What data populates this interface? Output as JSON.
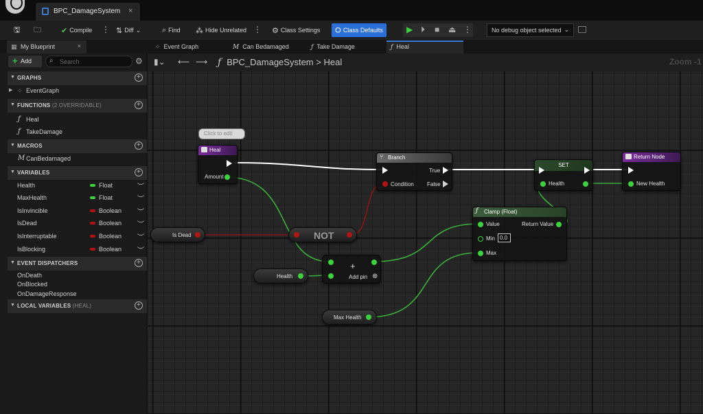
{
  "title_bar": {
    "document_tab": "BPC_DamageSystem",
    "close": "×"
  },
  "toolbar": {
    "compile": "Compile",
    "diff": "Diff",
    "find": "Find",
    "hide_unrelated": "Hide Unrelated",
    "class_settings": "Class Settings",
    "class_defaults": "Class Defaults",
    "debug_object": "No debug object selected",
    "accent": "#2a70d8"
  },
  "my_blueprint": {
    "tab_label": "My Blueprint",
    "close": "×",
    "add_label": "Add",
    "search_placeholder": "Search",
    "categories": {
      "graphs": "GRAPHS",
      "functions": "FUNCTIONS",
      "functions_sub": "(2 OVERRIDABLE)",
      "macros": "MACROS",
      "variables": "VARIABLES",
      "event_dispatchers": "EVENT DISPATCHERS",
      "local_variables": "LOCAL VARIABLES",
      "local_variables_sub": "(HEAL)"
    },
    "graphs": [
      "EventGraph"
    ],
    "functions": [
      "Heal",
      "TakeDamage"
    ],
    "macros": [
      "CanBedamaged"
    ],
    "variables": [
      {
        "name": "Health",
        "type": "Float",
        "color": "#3ed13e"
      },
      {
        "name": "MaxHealth",
        "type": "Float",
        "color": "#3ed13e"
      },
      {
        "name": "IsInvincible",
        "type": "Boolean",
        "color": "#b21313"
      },
      {
        "name": "IsDead",
        "type": "Boolean",
        "color": "#b21313"
      },
      {
        "name": "IsInterruptable",
        "type": "Boolean",
        "color": "#b21313"
      },
      {
        "name": "IsBlocking",
        "type": "Boolean",
        "color": "#b21313"
      }
    ],
    "event_dispatchers": [
      "OnDeath",
      "OnBlocked",
      "OnDamageResponse"
    ]
  },
  "graph_tabs": [
    "Event Graph",
    "Can Bedamaged",
    "Take Damage",
    "Heal"
  ],
  "breadcrumb": {
    "blueprint": "BPC_DamageSystem",
    "separator": ">",
    "function": "Heal",
    "zoom": "Zoom -1"
  },
  "nodes": {
    "comment_bubble": "Click to edit",
    "heal": {
      "title": "Heal",
      "pin_amount": "Amount"
    },
    "branch": {
      "title": "Branch",
      "pin_condition": "Condition",
      "pin_true": "True",
      "pin_false": "False"
    },
    "set": {
      "title": "SET",
      "pin_health": "Health"
    },
    "return": {
      "title": "Return Node",
      "pin_new_health": "New Health"
    },
    "is_dead": "Is Dead",
    "not": "NOT",
    "add": {
      "symbol": "+",
      "add_pin": "Add pin"
    },
    "health_getter": "Health",
    "clamp": {
      "title": "Clamp (Float)",
      "pin_value": "Value",
      "pin_return": "Return Value",
      "pin_min": "Min",
      "min_value": "0.0",
      "pin_max": "Max"
    },
    "max_health_getter": "Max Health"
  }
}
